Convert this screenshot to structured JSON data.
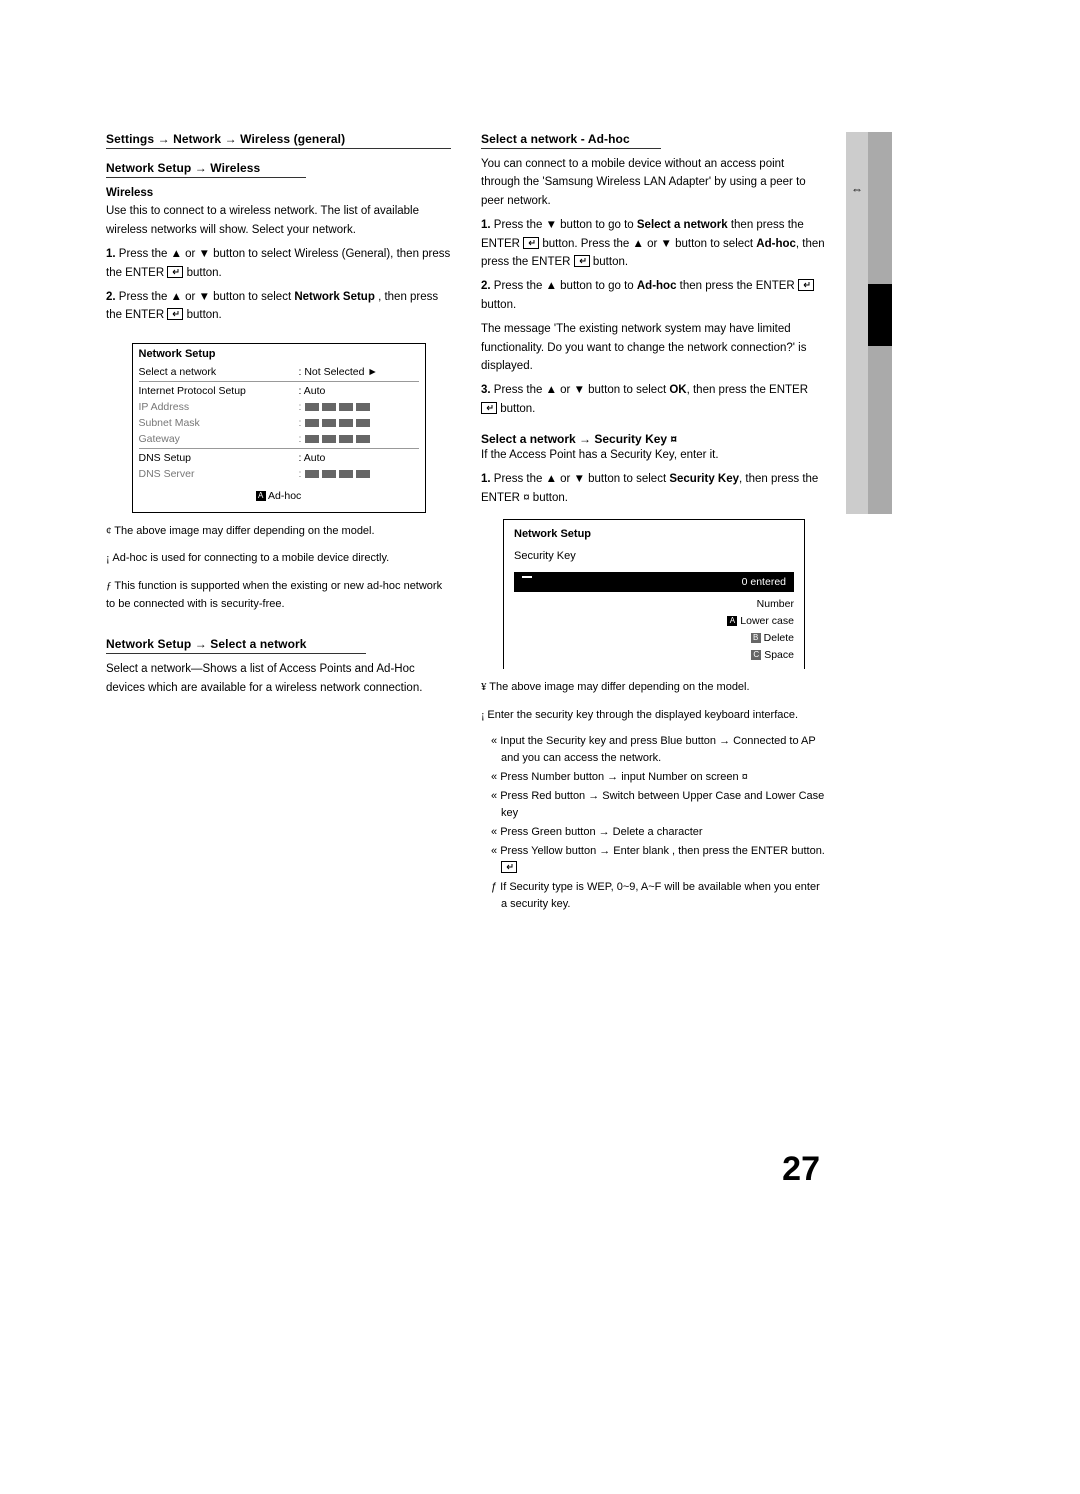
{
  "left": {
    "h1": "Settings → Network → Wireless (general)",
    "h2": "Network Setup → Wireless",
    "label_wireless": "Wireless",
    "intro": "Use this to connect to a wireless network. The list of available wireless networks will show. Select your network.",
    "step1": "Press the ▲ or ▼ button to select Wireless (General), then press the ENTER",
    "step1_tail": " button.",
    "step2_head": "Press the ▲ or ▼ button to select ",
    "step2_mid": "Network Setup",
    "step2_tail": ", then press the ENTER",
    "step2_end": " button.",
    "fig": {
      "title": "Network Setup",
      "rows": [
        {
          "k": "Select a network",
          "v": ": Not Selected   ►",
          "line": true,
          "dim": false
        },
        {
          "k": "Internet Protocol Setup",
          "v": ": Auto",
          "dim": false
        },
        {
          "k": "IP Address",
          "v": ":",
          "boxes": true,
          "dim": true
        },
        {
          "k": "Subnet Mask",
          "v": ":",
          "boxes": true,
          "dim": true
        },
        {
          "k": "Gateway",
          "v": ":",
          "boxes": true,
          "dim": true
        },
        {
          "k": "DNS Setup",
          "v": ": Auto",
          "line": true,
          "dim": false
        },
        {
          "k": "DNS Server",
          "v": ":",
          "boxes": true,
          "dim": true
        }
      ],
      "foot_a": "A",
      "foot_text": " Ad-hoc"
    },
    "foot1": "The above image may differ depending on the model.",
    "foot2": "Ad-hoc is used for connecting to a mobile device directly.",
    "note_sym": "ƒ",
    "note_text": " This function is supported when the existing or new ad-hoc network to be connected with is security-free.",
    "h3": "Network Setup → Select a network",
    "sel_intro": "Select a network—Shows a list of Access Points and Ad-Hoc devices which are available for a wireless network connection."
  },
  "right": {
    "h1": "Select a network - Ad-hoc",
    "p1": "You can connect to a mobile device without an access point through the 'Samsung Wireless LAN Adapter' by using a peer to peer network.",
    "p2_a": "Press the ▼ button to go to ",
    "p2_b": "Select a network",
    "p2_c": " then press the ENTER",
    "p2_d": " button. Press the ▲ or ▼ button to select ",
    "p2_e": "Ad-hoc",
    "p2_f": ", then press the ENTER",
    "p2_g": " button.",
    "p3_a": "Press the ▲ button to go to ",
    "p3_b": "Ad-hoc",
    "p3_c": " then press the ENTER",
    "p3_d": " button.",
    "msg1": "The message 'The existing network system may have limited functionality. Do you want to change the network connection?' is displayed.",
    "p4_a": "Press the ▲ or ▼ button to select ",
    "p4_b": "OK",
    "p4_c": ", then press the ENTER",
    "p4_d": " button.",
    "sec_h": "Select a network → Security Key",
    "sec_intro": "If the Access Point has a Security Key, enter it.",
    "sec_step_a": "Press the ▲ or ▼ button to select ",
    "sec_step_b": "Security Key",
    "sec_step_c": ", then press the ENTER",
    "sec_step_d": " button.",
    "fig": {
      "title": "Network Setup",
      "inner": "Security Key",
      "entered": "0 entered",
      "hints": [
        {
          "icon": "",
          "text": "Number"
        },
        {
          "icon": "A",
          "text": "Lower case"
        },
        {
          "icon": "B",
          "text": "Delete"
        },
        {
          "icon": "C",
          "text": "Space"
        }
      ]
    },
    "foot1": "The above image may differ depending on the model.",
    "foot2": "Enter the security key through the displayed keyboard interface.",
    "bullets": [
      "Input the Security key and press Blue button → Connected to AP and you can access the network.",
      "Press Number button → input Number on screen",
      "Press Red button → Switch between Upper Case and Lower Case key",
      "Press Green button → Delete a character",
      "Press Yellow button → Enter blank , then press the ENTER  button.",
      "ƒ  If Security type is WEP, 0~9, A~F will be available when you enter a security key."
    ]
  },
  "pageno": "27"
}
